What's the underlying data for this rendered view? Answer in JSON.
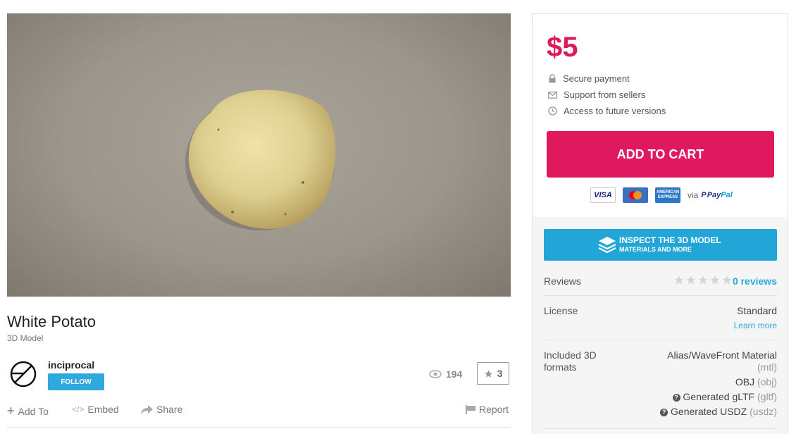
{
  "product": {
    "title": "White Potato",
    "subtitle": "3D Model",
    "seller": "inciprocal",
    "follow_label": "FOLLOW",
    "views": "194",
    "likes": "3"
  },
  "actions": {
    "add_to": "Add To",
    "embed": "Embed",
    "share": "Share",
    "report": "Report"
  },
  "purchase": {
    "price": "$5",
    "features": [
      "Secure payment",
      "Support from sellers",
      "Access to future versions"
    ],
    "cart_label": "ADD TO CART",
    "payment": {
      "visa": "VISA",
      "amex": "AMERICAN EXPRESS",
      "via": "via",
      "paypal_1": "Pay",
      "paypal_2": "Pal"
    }
  },
  "inspect": {
    "line1": "INSPECT THE 3D MODEL",
    "line2": "MATERIALS AND MORE"
  },
  "details": {
    "reviews_label": "Reviews",
    "reviews_value": "0 reviews",
    "license_label": "License",
    "license_value": "Standard",
    "learn_more": "Learn more",
    "formats_label": "Included 3D formats",
    "formats": [
      {
        "name": "Alias/WaveFront Material",
        "ext": "(mtl)"
      },
      {
        "name": "OBJ",
        "ext": "(obj)"
      },
      {
        "name": "Generated gLTF",
        "ext": "(gltf)"
      },
      {
        "name": "Generated USDZ",
        "ext": "(usdz)"
      }
    ]
  },
  "colors": {
    "accent": "#e0185d",
    "blue": "#2ea8dd"
  },
  "icons": [
    "lock-icon",
    "envelope-icon",
    "history-icon",
    "eye-icon",
    "star-icon",
    "plus-icon",
    "code-icon",
    "share-icon",
    "flag-icon",
    "layers-icon",
    "question-icon"
  ]
}
